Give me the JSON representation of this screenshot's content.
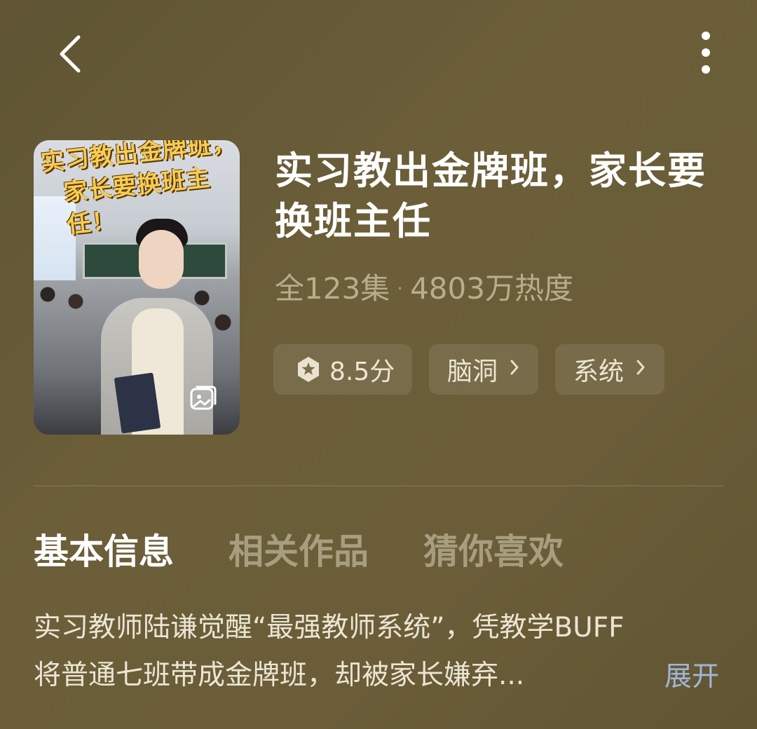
{
  "header": {
    "back_icon": "chevron-left-icon",
    "more_icon": "more-vertical-icon"
  },
  "cover": {
    "title_line1": "实习教出金牌班，",
    "title_line2": "家长要换班主任！",
    "corner_icon": "image-gallery-icon"
  },
  "drama": {
    "title": "实习教出金牌班，家长要换班主任",
    "episodes": "全123集",
    "separator": "·",
    "popularity": "4803万热度",
    "rating": "8.5分",
    "rating_icon": "star-badge-icon",
    "tags": [
      {
        "label": "脑洞",
        "icon": "chevron-right-icon"
      },
      {
        "label": "系统",
        "icon": "chevron-right-icon"
      }
    ]
  },
  "tabs": [
    {
      "label": "基本信息",
      "active": true
    },
    {
      "label": "相关作品",
      "active": false
    },
    {
      "label": "猜你喜欢",
      "active": false
    }
  ],
  "description": {
    "line1": "实习教师陆谦觉醒“最强教师系统”，凭教学BUFF",
    "line2": "将普通七班带成金牌班，却被家长嫌弃...",
    "expand_label": "展开"
  }
}
